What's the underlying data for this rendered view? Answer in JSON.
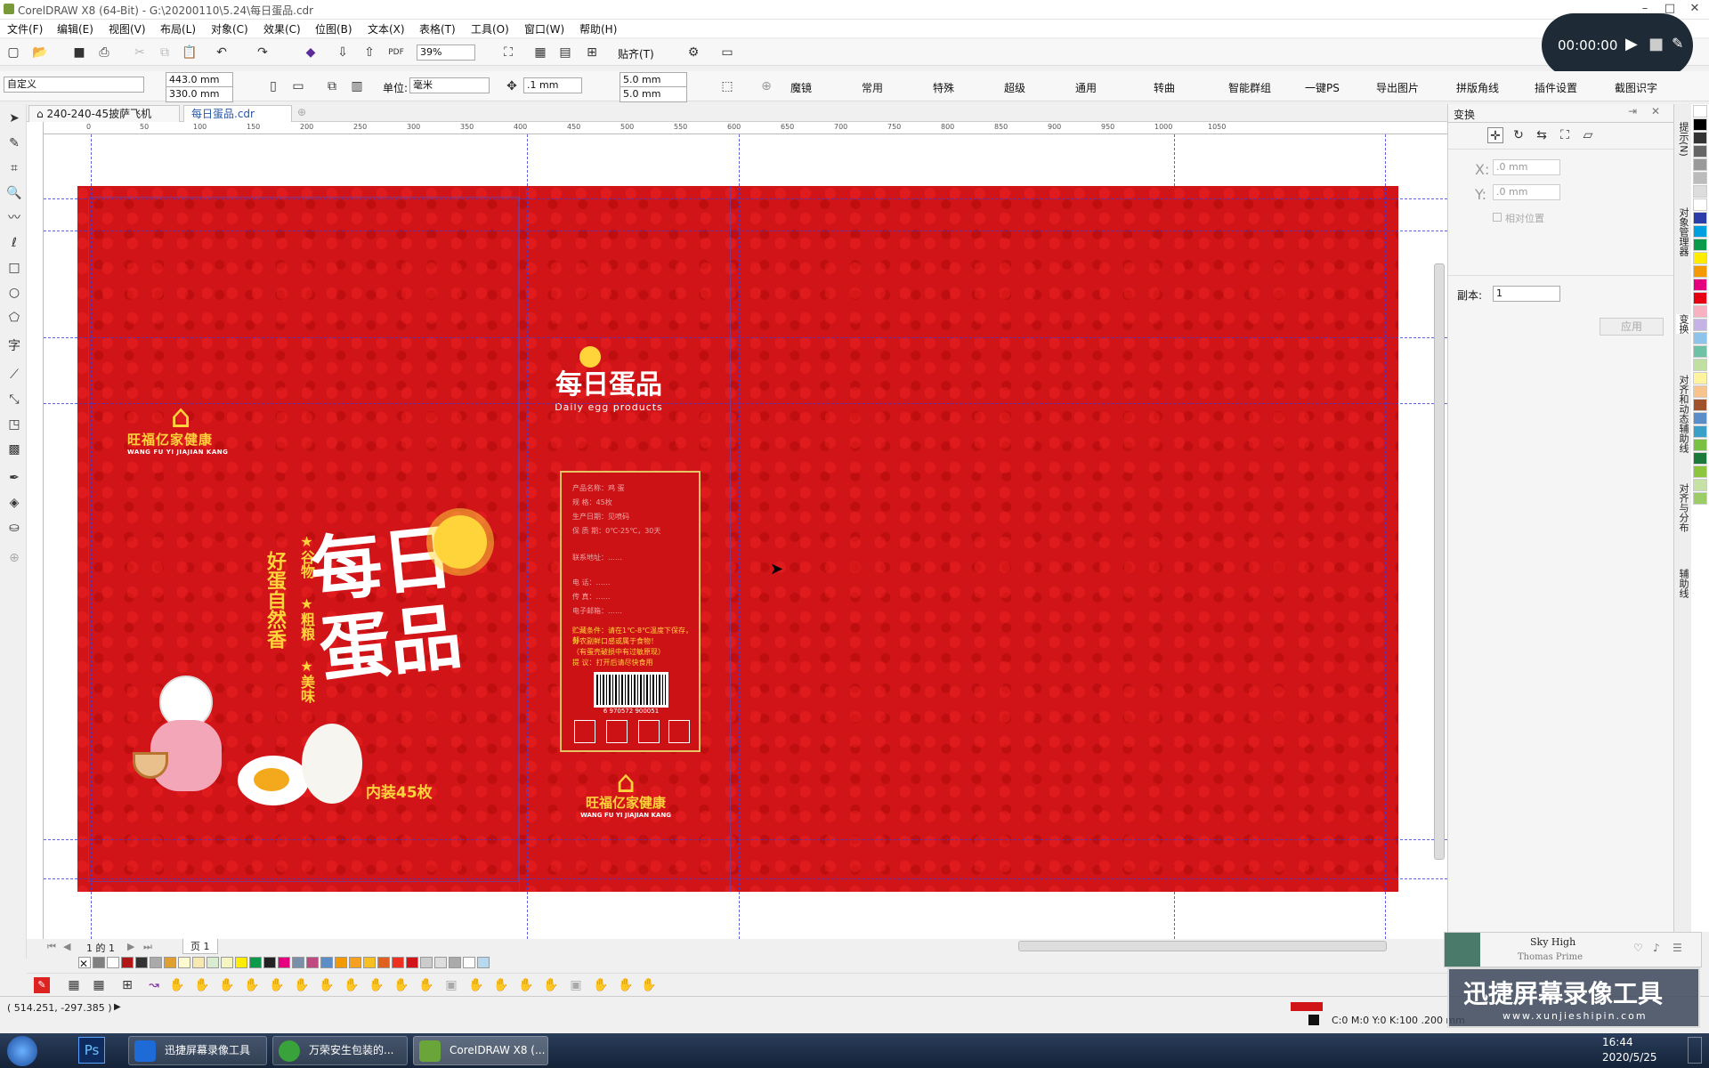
{
  "window": {
    "title": "CorelDRAW X8 (64-Bit) - G:\\20200110\\5.24\\每日蛋品.cdr",
    "min": "–",
    "max": "□",
    "close": "✕"
  },
  "menu": [
    "文件(F)",
    "编辑(E)",
    "视图(V)",
    "布局(L)",
    "对象(C)",
    "效果(C)",
    "位图(B)",
    "文本(X)",
    "表格(T)",
    "工具(O)",
    "窗口(W)",
    "帮助(H)"
  ],
  "toolbar1": {
    "zoom": "39%",
    "snap_label": "贴齐(T)"
  },
  "toolbar2": {
    "preset": "自定义",
    "width": "443.0 mm",
    "height": "330.0 mm",
    "unit_label": "单位:",
    "unit": "毫米",
    "nudge": ".1 mm",
    "dup_x": "5.0 mm",
    "dup_y": "5.0 mm",
    "plugins": [
      "魔镜",
      "常用",
      "特殊",
      "超级",
      "通用",
      "转曲",
      "智能群组",
      "一键PS",
      "导出图片",
      "拼版角线",
      "插件设置",
      "截图识字"
    ]
  },
  "recorder": {
    "time": "00:00:00"
  },
  "doc_tabs": [
    "240-240-45披萨飞机盒.cdr",
    "每日蛋品.cdr"
  ],
  "ruler": {
    "h_ticks": [
      "0",
      "50",
      "100",
      "150",
      "200",
      "250",
      "300",
      "350",
      "400",
      "450",
      "500",
      "550",
      "600",
      "650",
      "700",
      "750",
      "800",
      "850",
      "900",
      "950",
      "1000",
      "1050"
    ],
    "unit": "毫米"
  },
  "right_panel": {
    "title": "变换",
    "x_label": "X:",
    "x_value": ".0 mm",
    "y_label": "Y:",
    "y_value": ".0 mm",
    "relative_label": "相对位置",
    "copies_label": "副本:",
    "copies_value": "1",
    "apply": "应用"
  },
  "docker_tabs": [
    "提示(N)",
    "对象管理器",
    "变换",
    "对齐和动态辅助线",
    "对齐与分布",
    "辅助线"
  ],
  "artwork": {
    "brand_cn": "旺福亿家健康",
    "brand_en": "WANG FU YI JIAJIAN KANG",
    "title_cn": "每日蛋品",
    "title_en": "Daily egg products",
    "slogan_col1": "好蛋自然香",
    "features": [
      "★谷物",
      "★粗粮",
      "★美味"
    ],
    "count": "内装45枚",
    "barcode_num": "6 970572 900051",
    "info_lines": [
      "产品名称：鸡 蛋",
      "规 格：45枚",
      "生产日期：见喷码",
      "保 质 期：0℃-25℃，30天",
      "联系地址：……",
      "电 话：……",
      "传 真：……",
      "电子邮箱：……"
    ],
    "warn_lines": [
      "贮藏条件：请在1℃-8℃温度下保存，部",
      "分农副鲜口感或属于食物！",
      "（有蛋壳破损中有过敏原现）",
      "提 议：打开后请尽快食用"
    ]
  },
  "page_nav": {
    "count": "1 的 1",
    "page": "页 1"
  },
  "status": {
    "coords": "( 514.251, -297.385 )",
    "fill_info": "C:0 M:0 Y:0 K:100  .200 mm"
  },
  "taskbar": {
    "tasks": [
      "迅捷屏幕录像工具",
      "万荣安生包装的...",
      "CoreIDRAW X8 (..."
    ],
    "time": "16:44",
    "date": "2020/5/25"
  },
  "music": {
    "song": "Sky High",
    "artist": "Thomas Prime"
  },
  "watermark": {
    "text": "迅捷屏幕录像工具",
    "url": "www.xunjieshipin.com"
  },
  "colors": {
    "art_red": "#d01417",
    "gold": "#ffd43a",
    "guide_blue": "#3b3bd9"
  }
}
